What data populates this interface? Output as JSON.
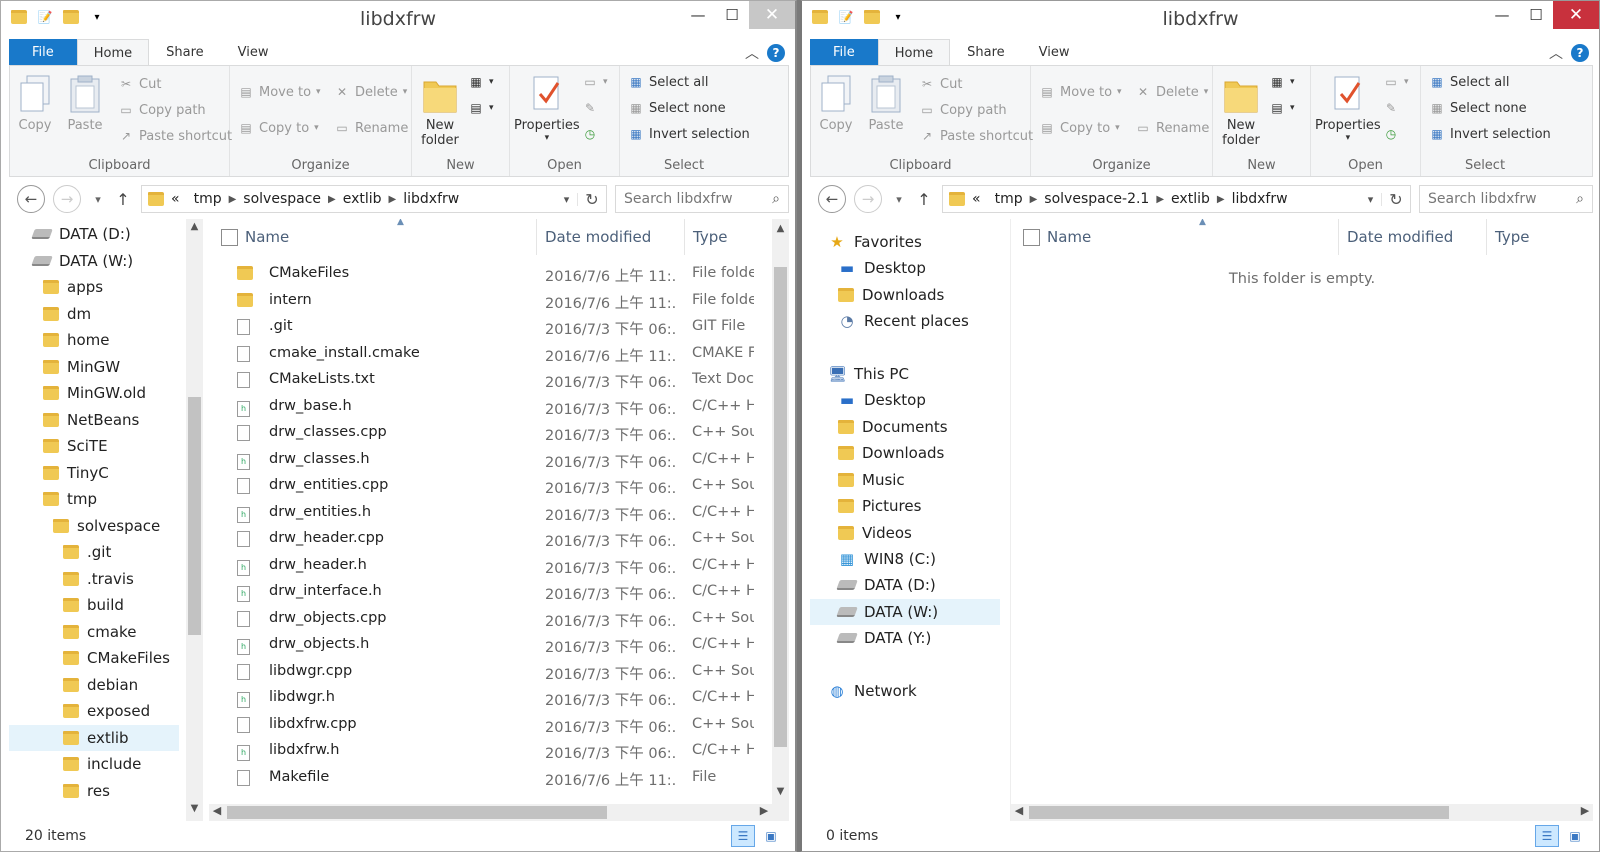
{
  "colors": {
    "file_tab": "#1979ca",
    "close_active": "#c8313d",
    "selection": "#e5f3fb",
    "folder": "#f0c954"
  },
  "left": {
    "title": "libdxfrw",
    "tabs": {
      "file": "File",
      "home": "Home",
      "share": "Share",
      "view": "View"
    },
    "ribbon": {
      "clipboard": {
        "copy": "Copy",
        "paste": "Paste",
        "cut": "Cut",
        "copy_path": "Copy path",
        "paste_shortcut": "Paste shortcut",
        "label": "Clipboard"
      },
      "organize": {
        "move_to": "Move to",
        "copy_to": "Copy to",
        "delete": "Delete",
        "rename": "Rename",
        "label": "Organize"
      },
      "new": {
        "new_folder": "New folder",
        "label": "New"
      },
      "open": {
        "properties": "Properties",
        "label": "Open"
      },
      "select": {
        "select_all": "Select all",
        "select_none": "Select none",
        "invert": "Invert selection",
        "label": "Select"
      }
    },
    "address": {
      "overflow": "«",
      "segments": [
        "tmp",
        "solvespace",
        "extlib",
        "libdxfrw"
      ]
    },
    "search_placeholder": "Search libdxfrw",
    "tree": [
      {
        "label": "DATA (D:)",
        "kind": "drive"
      },
      {
        "label": "DATA (W:)",
        "kind": "drive"
      },
      {
        "label": "apps",
        "kind": "folder"
      },
      {
        "label": "dm",
        "kind": "folder"
      },
      {
        "label": "home",
        "kind": "folder"
      },
      {
        "label": "MinGW",
        "kind": "folder"
      },
      {
        "label": "MinGW.old",
        "kind": "folder"
      },
      {
        "label": "NetBeans",
        "kind": "folder"
      },
      {
        "label": "SciTE",
        "kind": "folder"
      },
      {
        "label": "TinyC",
        "kind": "folder"
      },
      {
        "label": "tmp",
        "kind": "folder"
      },
      {
        "label": "solvespace",
        "kind": "folder"
      },
      {
        "label": ".git",
        "kind": "folder"
      },
      {
        "label": ".travis",
        "kind": "folder"
      },
      {
        "label": "build",
        "kind": "folder"
      },
      {
        "label": "cmake",
        "kind": "folder"
      },
      {
        "label": "CMakeFiles",
        "kind": "folder"
      },
      {
        "label": "debian",
        "kind": "folder"
      },
      {
        "label": "exposed",
        "kind": "folder"
      },
      {
        "label": "extlib",
        "kind": "folder"
      },
      {
        "label": "include",
        "kind": "folder"
      },
      {
        "label": "res",
        "kind": "folder"
      }
    ],
    "columns": {
      "name": "Name",
      "date": "Date modified",
      "type": "Type"
    },
    "files": [
      {
        "name": "CMakeFiles",
        "date": "2016/7/6 上午 11:...",
        "type": "File folder",
        "kind": "folder"
      },
      {
        "name": "intern",
        "date": "2016/7/6 上午 11:...",
        "type": "File folder",
        "kind": "folder"
      },
      {
        "name": ".git",
        "date": "2016/7/3 下午 06:...",
        "type": "GIT File",
        "kind": "file"
      },
      {
        "name": "cmake_install.cmake",
        "date": "2016/7/6 上午 11:...",
        "type": "CMAKE File",
        "kind": "file"
      },
      {
        "name": "CMakeLists.txt",
        "date": "2016/7/3 下午 06:...",
        "type": "Text Document",
        "kind": "file"
      },
      {
        "name": "drw_base.h",
        "date": "2016/7/3 下午 06:...",
        "type": "C/C++ Header",
        "kind": "h"
      },
      {
        "name": "drw_classes.cpp",
        "date": "2016/7/3 下午 06:...",
        "type": "C++ Source",
        "kind": "cpp"
      },
      {
        "name": "drw_classes.h",
        "date": "2016/7/3 下午 06:...",
        "type": "C/C++ Header",
        "kind": "h"
      },
      {
        "name": "drw_entities.cpp",
        "date": "2016/7/3 下午 06:...",
        "type": "C++ Source",
        "kind": "cpp"
      },
      {
        "name": "drw_entities.h",
        "date": "2016/7/3 下午 06:...",
        "type": "C/C++ Header",
        "kind": "h"
      },
      {
        "name": "drw_header.cpp",
        "date": "2016/7/3 下午 06:...",
        "type": "C++ Source",
        "kind": "cpp"
      },
      {
        "name": "drw_header.h",
        "date": "2016/7/3 下午 06:...",
        "type": "C/C++ Header",
        "kind": "h"
      },
      {
        "name": "drw_interface.h",
        "date": "2016/7/3 下午 06:...",
        "type": "C/C++ Header",
        "kind": "h"
      },
      {
        "name": "drw_objects.cpp",
        "date": "2016/7/3 下午 06:...",
        "type": "C++ Source",
        "kind": "cpp"
      },
      {
        "name": "drw_objects.h",
        "date": "2016/7/3 下午 06:...",
        "type": "C/C++ Header",
        "kind": "h"
      },
      {
        "name": "libdwgr.cpp",
        "date": "2016/7/3 下午 06:...",
        "type": "C++ Source",
        "kind": "cpp"
      },
      {
        "name": "libdwgr.h",
        "date": "2016/7/3 下午 06:...",
        "type": "C/C++ Header",
        "kind": "h"
      },
      {
        "name": "libdxfrw.cpp",
        "date": "2016/7/3 下午 06:...",
        "type": "C++ Source",
        "kind": "cpp"
      },
      {
        "name": "libdxfrw.h",
        "date": "2016/7/3 下午 06:...",
        "type": "C/C++ Header",
        "kind": "h"
      },
      {
        "name": "Makefile",
        "date": "2016/7/6 上午 11:...",
        "type": "File",
        "kind": "file"
      }
    ],
    "status": "20 items"
  },
  "right": {
    "title": "libdxfrw",
    "tabs": {
      "file": "File",
      "home": "Home",
      "share": "Share",
      "view": "View"
    },
    "ribbon": {
      "clipboard": {
        "copy": "Copy",
        "paste": "Paste",
        "cut": "Cut",
        "copy_path": "Copy path",
        "paste_shortcut": "Paste shortcut",
        "label": "Clipboard"
      },
      "organize": {
        "move_to": "Move to",
        "copy_to": "Copy to",
        "delete": "Delete",
        "rename": "Rename",
        "label": "Organize"
      },
      "new": {
        "new_folder": "New folder",
        "label": "New"
      },
      "open": {
        "properties": "Properties",
        "label": "Open"
      },
      "select": {
        "select_all": "Select all",
        "select_none": "Select none",
        "invert": "Invert selection",
        "label": "Select"
      }
    },
    "address": {
      "overflow": "«",
      "segments": [
        "tmp",
        "solvespace-2.1",
        "extlib",
        "libdxfrw"
      ]
    },
    "search_placeholder": "Search libdxfrw",
    "tree": [
      {
        "label": "Favorites",
        "kind": "star"
      },
      {
        "label": "Desktop",
        "kind": "desktop"
      },
      {
        "label": "Downloads",
        "kind": "folder"
      },
      {
        "label": "Recent places",
        "kind": "recent"
      },
      {
        "label": "This PC",
        "kind": "pc"
      },
      {
        "label": "Desktop",
        "kind": "desktop"
      },
      {
        "label": "Documents",
        "kind": "folder"
      },
      {
        "label": "Downloads",
        "kind": "folder"
      },
      {
        "label": "Music",
        "kind": "folder"
      },
      {
        "label": "Pictures",
        "kind": "folder"
      },
      {
        "label": "Videos",
        "kind": "folder"
      },
      {
        "label": "WIN8 (C:)",
        "kind": "windrive"
      },
      {
        "label": "DATA (D:)",
        "kind": "drive"
      },
      {
        "label": "DATA (W:)",
        "kind": "drive"
      },
      {
        "label": "DATA (Y:)",
        "kind": "drive"
      },
      {
        "label": "Network",
        "kind": "network"
      }
    ],
    "columns": {
      "name": "Name",
      "date": "Date modified",
      "type": "Type"
    },
    "empty_message": "This folder is empty.",
    "status": "0 items"
  }
}
